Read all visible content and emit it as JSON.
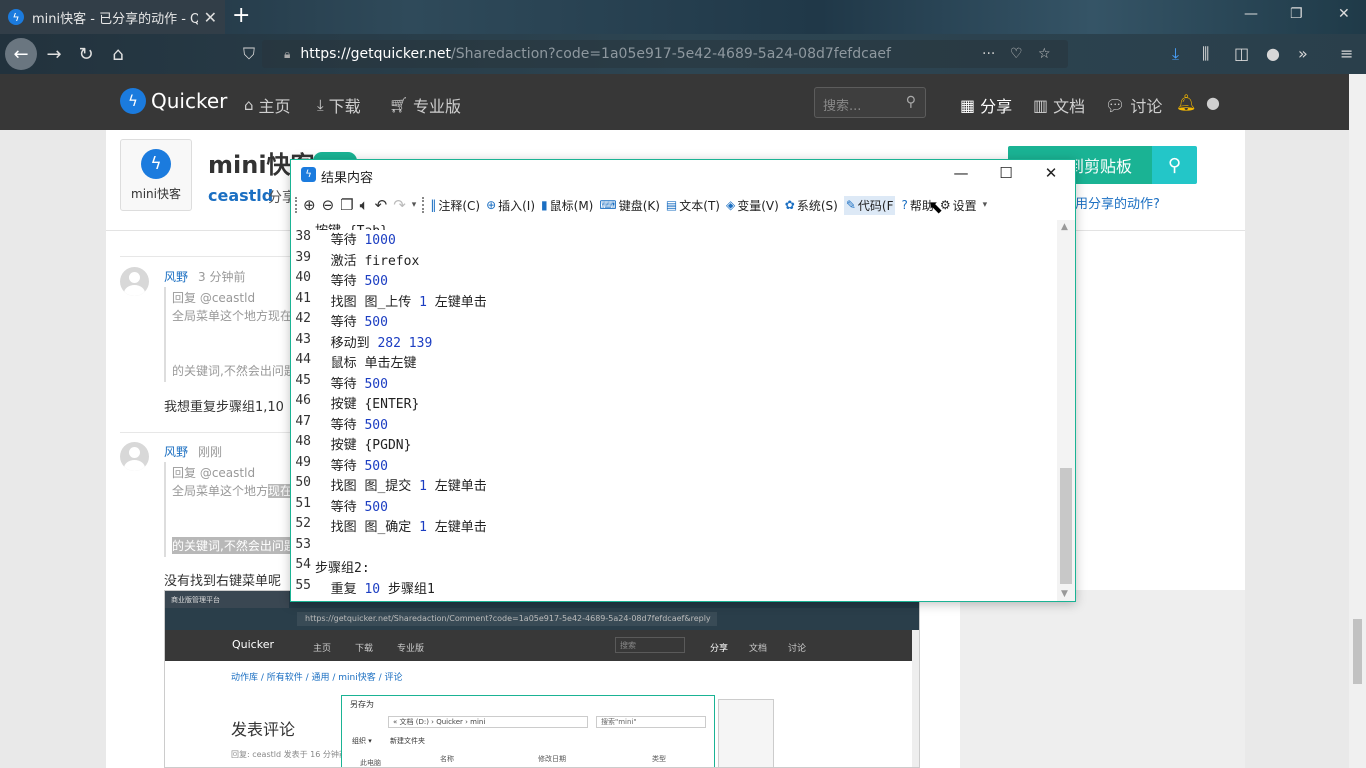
{
  "browser": {
    "tab_title": "mini快客 - 已分享的动作 - Qu",
    "tab_close": "✕",
    "new_tab": "+",
    "url_host": "https://getquicker.net",
    "url_rest": "/Sharedaction?code=1a05e917-5e42-4689-5a24-08d7fefdcaef",
    "url_more": "···"
  },
  "site": {
    "logo": "Quicker",
    "nav": [
      "主页",
      "下载",
      "专业版"
    ],
    "search_placeholder": "搜索...",
    "right_nav": [
      "分享",
      "文档",
      "讨论"
    ]
  },
  "action": {
    "icon_caption": "mini快客",
    "title": "mini快客",
    "author": "ceastld",
    "author_suffix": "分享",
    "copy_button": "到剪贴板",
    "howto": "用分享的动作?"
  },
  "comments": [
    {
      "user": "风野",
      "time": "3 分钟前",
      "reply_to": "回复 @ceastld",
      "quote_line1": "全局菜单这个地方现在",
      "quote_line2": "的关键词,不然会出问题",
      "body": "我想重复步骤组1,10"
    },
    {
      "user": "风野",
      "time": "刚刚",
      "reply_to": "回复 @ceastld",
      "quote_line1_a": "全局菜单这个地方",
      "quote_line1_b": "现在",
      "quote_line2": "的关键词,不然会出问题",
      "body": "没有找到右键菜单呢"
    }
  ],
  "embedded_shot": {
    "tab": "商业版管理平台",
    "url": "https://getquicker.net/Sharedaction/Comment?code=1a05e917-5e42-4689-5a24-08d7fefdcaef&reply",
    "logo": "Quicker",
    "nav": [
      "主页",
      "下载",
      "专业版"
    ],
    "search": "搜索",
    "right_nav": [
      "分享",
      "文档",
      "讨论"
    ],
    "breadcrumb": "动作库 / 所有软件 / 通用 / mini快客 / 评论",
    "heading": "发表评论",
    "meta": "回复: ceastld 发表于 16 分钟前",
    "dialog_title": "另存为",
    "dialog_path": "« 文档 (D:) › Quicker › mini",
    "dialog_search": "搜索\"mini\"",
    "dialog_organize": "组织 ▾",
    "dialog_new_folder": "新建文件夹",
    "dialog_col_name": "名称",
    "dialog_col_date": "修改日期",
    "dialog_col_type": "类型",
    "dialog_sidebar": "此电脑"
  },
  "qwin": {
    "title": "结果内容",
    "toolbar": {
      "comment": "注释(C)",
      "insert": "插入(I)",
      "mouse": "鼠标(M)",
      "keyboard": "键盘(K)",
      "text": "文本(T)",
      "variable": "变量(V)",
      "system": "系统(S)",
      "code": "代码(F",
      "help": "帮助",
      "settings": "设置"
    },
    "cut_line": "按键 {Tab}",
    "lines": [
      {
        "n": "38",
        "a": "  等待 ",
        "num": "1000",
        "b": ""
      },
      {
        "n": "39",
        "a": "  激活 firefox",
        "num": "",
        "b": ""
      },
      {
        "n": "40",
        "a": "  等待 ",
        "num": "500",
        "b": ""
      },
      {
        "n": "41",
        "a": "  找图 图_上传 ",
        "num": "1",
        "b": " 左键单击"
      },
      {
        "n": "42",
        "a": "  等待 ",
        "num": "500",
        "b": ""
      },
      {
        "n": "43",
        "a": "  移动到 ",
        "num": "282 139",
        "b": ""
      },
      {
        "n": "44",
        "a": "  鼠标 单击左键",
        "num": "",
        "b": ""
      },
      {
        "n": "45",
        "a": "  等待 ",
        "num": "500",
        "b": ""
      },
      {
        "n": "46",
        "a": "  按键 {ENTER}",
        "num": "",
        "b": ""
      },
      {
        "n": "47",
        "a": "  等待 ",
        "num": "500",
        "b": ""
      },
      {
        "n": "48",
        "a": "  按键 {PGDN}",
        "num": "",
        "b": ""
      },
      {
        "n": "49",
        "a": "  等待 ",
        "num": "500",
        "b": ""
      },
      {
        "n": "50",
        "a": "  找图 图_提交 ",
        "num": "1",
        "b": " 左键单击"
      },
      {
        "n": "51",
        "a": "  等待 ",
        "num": "500",
        "b": ""
      },
      {
        "n": "52",
        "a": "  找图 图_确定 ",
        "num": "1",
        "b": " 左键单击"
      },
      {
        "n": "53",
        "a": "",
        "num": "",
        "b": ""
      },
      {
        "n": "54",
        "a": "步骤组2:",
        "num": "",
        "b": ""
      },
      {
        "n": "55",
        "a": "  重复 ",
        "num": "10",
        "b": " 步骤组1"
      }
    ]
  },
  "colors": {
    "accent_green": "#1ab394",
    "accent_teal": "#23c6c8",
    "link_blue": "#1b6fc2",
    "number_blue": "#1b3dc2"
  }
}
